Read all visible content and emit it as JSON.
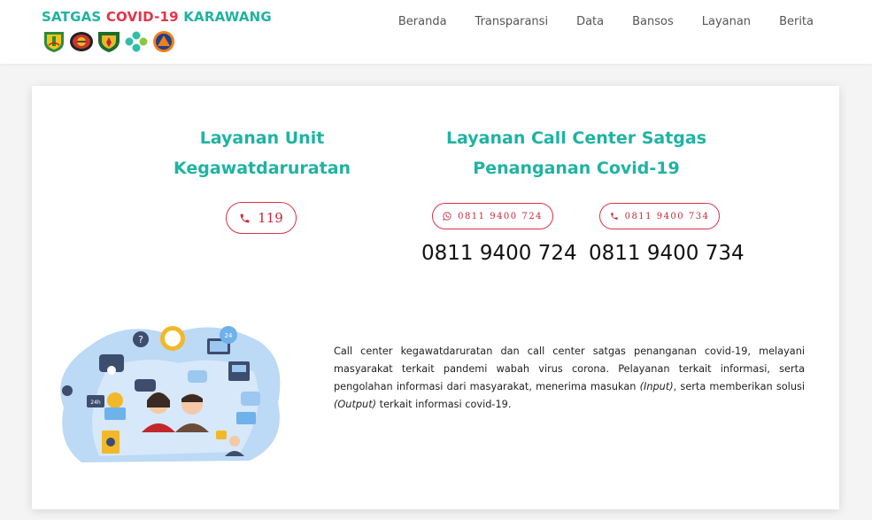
{
  "header": {
    "brand": {
      "part1": "SATGAS ",
      "part2": "COVID-19",
      "part3": " KARAWANG"
    },
    "logos": [
      "karawang-regency-logo",
      "police-logo",
      "military-logo",
      "ministry-of-health-logo",
      "bnpb-logo"
    ],
    "nav": [
      "Beranda",
      "Transparansi",
      "Data",
      "Bansos",
      "Layanan",
      "Berita"
    ]
  },
  "emergency": {
    "title_line1": "Layanan Unit",
    "title_line2": "Kegawatdaruratan",
    "phone_button": "119"
  },
  "call_center": {
    "title_line1": "Layanan Call Center Satgas",
    "title_line2": "Penanganan Covid-19",
    "whatsapp_button": "0811 9400 724",
    "phone_button": "0811 9400 734",
    "number_1": "0811 9400 724",
    "number_2": "0811 9400 734"
  },
  "description": {
    "text_1": "Call center kegawatdaruratan dan call center satgas penanganan covid-19, melayani masyarakat terkait pandemi wabah virus corona. Pelayanan terkait informasi, serta pengolahan informasi dari masyarakat, menerima masukan ",
    "italic_1": "(Input)",
    "text_2": ", serta memberikan solusi ",
    "italic_2": "(Output)",
    "text_3": " terkait informasi covid-19."
  },
  "colors": {
    "teal": "#1fb3a2",
    "red": "#d9334a",
    "illustration_blue": "#bcd9f5"
  },
  "illustration": {
    "badge_24h": "24h",
    "badge_24": "24"
  }
}
